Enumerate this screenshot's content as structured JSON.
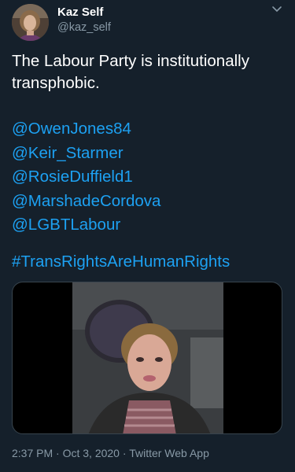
{
  "author": {
    "display_name": "Kaz Self",
    "handle": "@kaz_self"
  },
  "tweet": {
    "text_line1": "The Labour Party is institutionally",
    "text_line2": "transphobic.",
    "mentions": [
      "@OwenJones84",
      "@Keir_Starmer",
      "@RosieDuffield1",
      "@MarshadeCordova",
      "@LGBTLabour"
    ],
    "hashtag": "#TransRightsAreHumanRights"
  },
  "meta": {
    "time": "2:37 PM",
    "separator": "·",
    "date": "Oct 3, 2020",
    "source": "Twitter Web App"
  },
  "colors": {
    "background": "#15202b",
    "link": "#1da1f2",
    "secondary_text": "#8899a6",
    "primary_text": "#ffffff"
  },
  "icons": [
    "avatar-photo",
    "chevron-down-icon",
    "video-thumbnail"
  ]
}
